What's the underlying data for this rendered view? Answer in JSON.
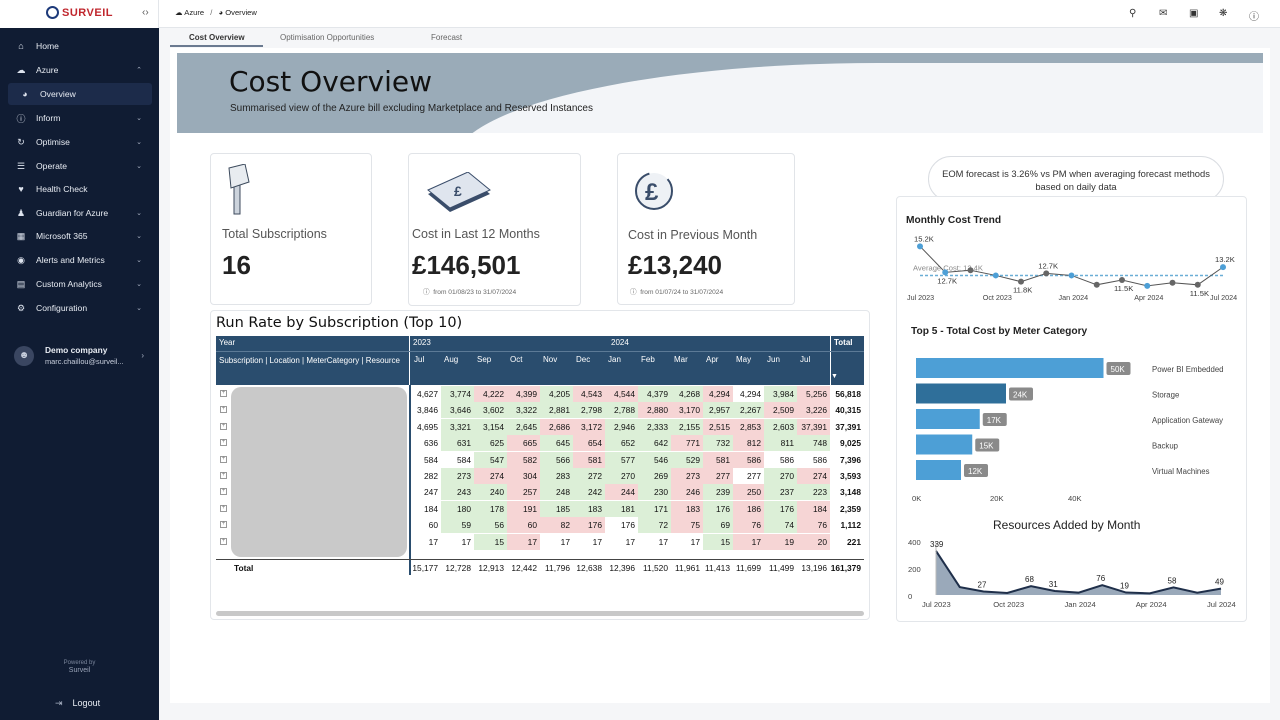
{
  "app": {
    "logo_text": "SURVEIL",
    "collapse_icon": "chevrons-left-icon"
  },
  "sidebar": {
    "items": [
      {
        "label": "Home",
        "icon": "home-icon",
        "chevron": false,
        "active": false
      },
      {
        "label": "Azure",
        "icon": "cloud-icon",
        "chevron": "up",
        "active": false
      },
      {
        "label": "Overview",
        "icon": "pie-chart-icon",
        "chevron": false,
        "active": true,
        "sub": true
      },
      {
        "label": "Inform",
        "icon": "info-icon",
        "chevron": "down",
        "active": false
      },
      {
        "label": "Optimise",
        "icon": "refresh-icon",
        "chevron": "down",
        "active": false
      },
      {
        "label": "Operate",
        "icon": "sliders-icon",
        "chevron": "down",
        "active": false
      },
      {
        "label": "Health Check",
        "icon": "heartbeat-icon",
        "chevron": false,
        "active": false
      },
      {
        "label": "Guardian for Azure",
        "icon": "user-shield-icon",
        "chevron": "down",
        "active": false
      },
      {
        "label": "Microsoft 365",
        "icon": "grid-icon",
        "chevron": "down",
        "active": false
      },
      {
        "label": "Alerts and Metrics",
        "icon": "globe-icon",
        "chevron": "down",
        "active": false
      },
      {
        "label": "Custom Analytics",
        "icon": "chart-icon",
        "chevron": "down",
        "active": false
      },
      {
        "label": "Configuration",
        "icon": "users-cog-icon",
        "chevron": "down",
        "active": false
      }
    ],
    "user": {
      "name": "Demo company",
      "email": "marc.chaillou@surveil..."
    },
    "powered_by": "Powered by",
    "powered_brand": "Surveil",
    "logout": "Logout"
  },
  "breadcrumb": {
    "root": "Azure",
    "separator": "/",
    "current": "Overview"
  },
  "tabs": [
    "Cost Overview",
    "Optimisation Opportunities",
    "Forecast"
  ],
  "banner": {
    "title": "Cost Overview",
    "subtitle": "Summarised view of the Azure bill excluding Marketplace and Reserved Instances"
  },
  "cards": {
    "subs": {
      "label": "Total Subscriptions",
      "value": "16"
    },
    "last12": {
      "label": "Cost in Last 12 Months",
      "value": "£146,501",
      "date": "from 01/08/23 to 31/07/2024"
    },
    "prev": {
      "label": "Cost in Previous Month",
      "value": "£13,240",
      "date": "from 01/07/24 to 31/07/2024"
    }
  },
  "forecast_note": "EOM forecast is 3.26% vs PM when averaging forecast methods based on daily data",
  "runrate": {
    "title": "Run Rate by Subscription (Top 10)",
    "year_label": "Year",
    "row_header": "Subscription | Location | MeterCategory | Resource",
    "years": [
      "2023",
      "2024"
    ],
    "total_label": "Total",
    "months": [
      "Jul",
      "Aug",
      "Sep",
      "Oct",
      "Nov",
      "Dec",
      "Jan",
      "Feb",
      "Mar",
      "Apr",
      "May",
      "Jun",
      "Jul"
    ],
    "rows": [
      [
        "4,627",
        "3,774",
        "4,222",
        "4,399",
        "4,205",
        "4,543",
        "4,544",
        "4,379",
        "4,268",
        "4,294",
        "4,294",
        "3,984",
        "5,256",
        "56,818"
      ],
      [
        "3,846",
        "3,646",
        "3,602",
        "3,322",
        "2,881",
        "2,798",
        "2,788",
        "2,880",
        "3,170",
        "2,957",
        "2,267",
        "2,509",
        "3,226",
        "40,315"
      ],
      [
        "4,695",
        "3,321",
        "3,154",
        "2,645",
        "2,686",
        "3,172",
        "2,946",
        "2,333",
        "2,155",
        "2,515",
        "2,853",
        "2,603",
        "37,391",
        "37,391"
      ],
      [
        "636",
        "631",
        "625",
        "665",
        "645",
        "654",
        "652",
        "642",
        "771",
        "732",
        "812",
        "811",
        "748",
        "9,025"
      ],
      [
        "584",
        "584",
        "547",
        "582",
        "566",
        "581",
        "577",
        "546",
        "529",
        "581",
        "586",
        "586",
        "586",
        "7,396"
      ],
      [
        "282",
        "273",
        "274",
        "304",
        "283",
        "272",
        "270",
        "269",
        "273",
        "277",
        "277",
        "270",
        "274",
        "3,593"
      ],
      [
        "247",
        "243",
        "240",
        "257",
        "248",
        "242",
        "244",
        "230",
        "246",
        "239",
        "250",
        "237",
        "223",
        "3,148"
      ],
      [
        "184",
        "180",
        "178",
        "191",
        "185",
        "183",
        "181",
        "171",
        "183",
        "176",
        "186",
        "176",
        "184",
        "2,359"
      ],
      [
        "60",
        "59",
        "56",
        "60",
        "82",
        "176",
        "176",
        "72",
        "75",
        "69",
        "76",
        "74",
        "76",
        "1,112"
      ],
      [
        "17",
        "17",
        "15",
        "17",
        "17",
        "17",
        "17",
        "17",
        "17",
        "15",
        "17",
        "19",
        "20",
        "221"
      ]
    ],
    "totals": [
      "15,177",
      "12,728",
      "12,913",
      "12,442",
      "11,796",
      "12,638",
      "12,396",
      "11,520",
      "11,961",
      "11,413",
      "11,699",
      "11,499",
      "13,196",
      "161,379"
    ]
  },
  "colors": {
    "sidebar": "#101c33",
    "header": "#2a4d6e",
    "bar_light": "#4d9fd6",
    "bar_dark": "#2f6f9a",
    "red_cell": "#f6d5d5",
    "green_cell": "#dcefd7"
  },
  "monthly_trend": {
    "title": "Monthly Cost Trend",
    "avg_label": "Average Cost: 12.4K",
    "labels": [
      "15.2K",
      "12.7K",
      "11.8K",
      "12.7K",
      "11.5K",
      "11.5K",
      "13.2K"
    ],
    "x_ticks": [
      "Jul 2023",
      "Oct 2023",
      "Jan 2024",
      "Apr 2024",
      "Jul 2024"
    ],
    "chart_data": {
      "type": "line",
      "x": [
        "Jul 2023",
        "Aug 2023",
        "Sep 2023",
        "Oct 2023",
        "Nov 2023",
        "Dec 2023",
        "Jan 2024",
        "Feb 2024",
        "Mar 2024",
        "Apr 2024",
        "May 2024",
        "Jun 2024",
        "Jul 2024"
      ],
      "values": [
        15.2,
        12.7,
        12.9,
        12.4,
        11.8,
        12.6,
        12.4,
        11.5,
        11.96,
        11.4,
        11.7,
        11.5,
        13.2
      ],
      "average": 12.4
    }
  },
  "top5": {
    "title": "Top 5 - Total Cost by Meter Category",
    "chart_data": {
      "type": "bar",
      "categories": [
        "Power BI Embedded",
        "Storage",
        "Application Gateway",
        "Backup",
        "Virtual Machines"
      ],
      "values": [
        50,
        24,
        17,
        15,
        12
      ],
      "value_labels": [
        "50K",
        "24K",
        "17K",
        "15K",
        "12K"
      ],
      "x_ticks": [
        "0K",
        "20K",
        "40K"
      ],
      "xlim": [
        0,
        52
      ]
    }
  },
  "resources": {
    "title": "Resources Added by Month",
    "y_ticks": [
      "400",
      "200",
      "0"
    ],
    "x_ticks": [
      "Jul 2023",
      "Oct 2023",
      "Jan 2024",
      "Apr 2024",
      "Jul 2024"
    ],
    "chart_data": {
      "type": "area",
      "x": [
        "Jul 2023",
        "Aug 2023",
        "Sep 2023",
        "Oct 2023",
        "Nov 2023",
        "Dec 2023",
        "Jan 2024",
        "Feb 2024",
        "Mar 2024",
        "Apr 2024",
        "May 2024",
        "Jun 2024",
        "Jul 2024"
      ],
      "values": [
        339,
        null,
        27,
        null,
        68,
        31,
        null,
        76,
        19,
        null,
        58,
        null,
        49
      ],
      "ylim": [
        0,
        400
      ]
    }
  }
}
